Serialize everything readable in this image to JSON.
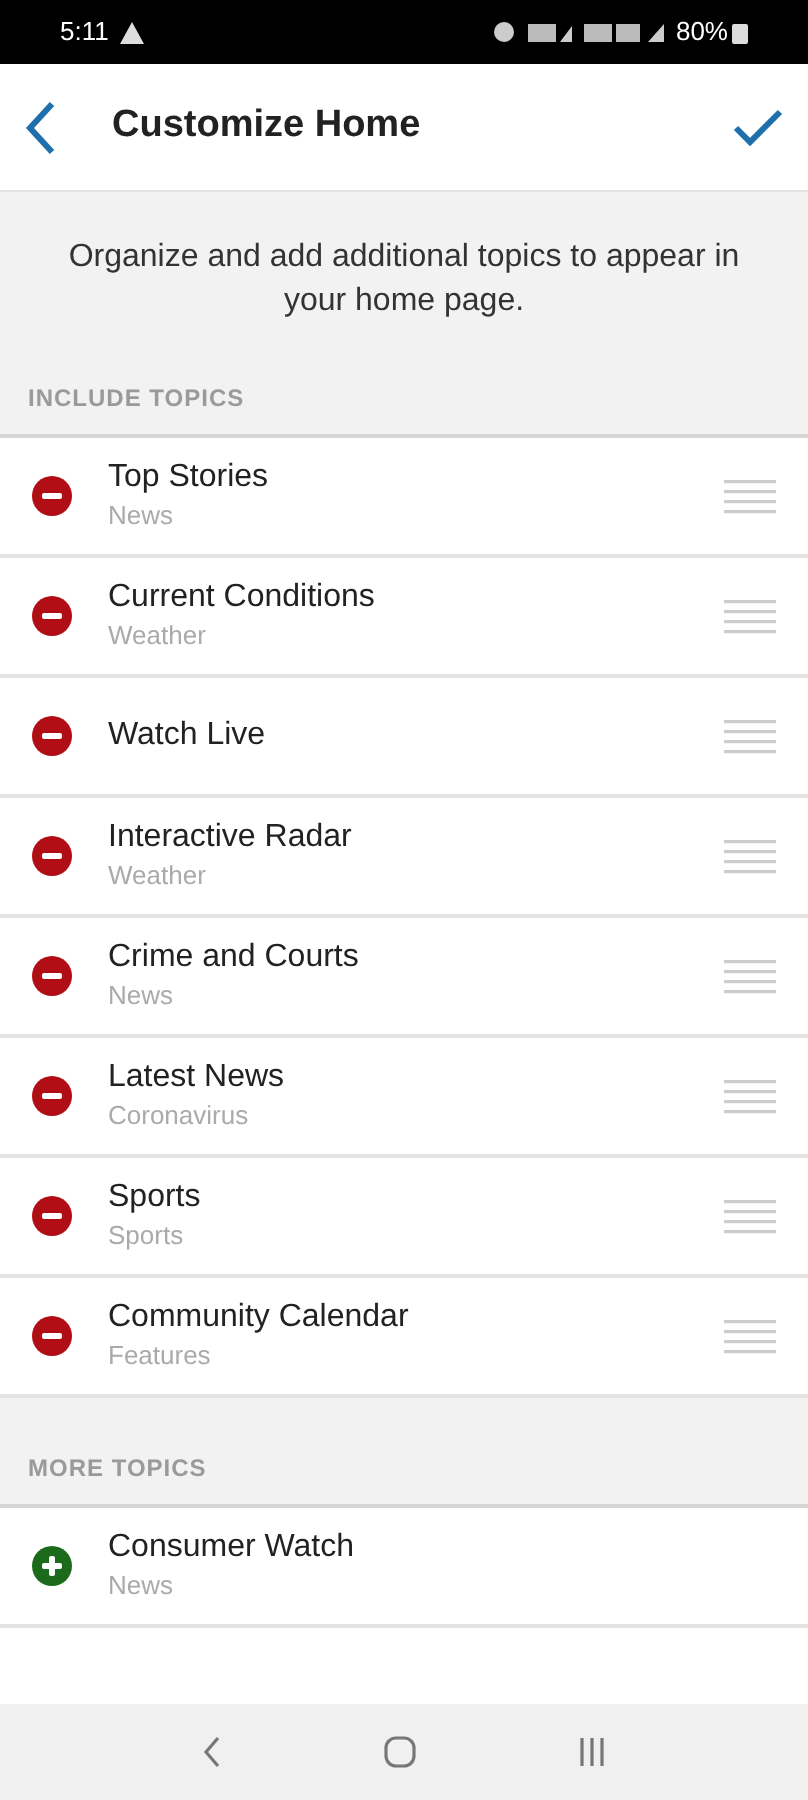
{
  "status_bar": {
    "time": "5:11",
    "battery": "80%"
  },
  "header": {
    "title": "Customize Home"
  },
  "intro": "Organize and add additional topics to appear in your home page.",
  "sections": [
    {
      "title": "INCLUDE TOPICS",
      "items": [
        {
          "name": "Top Stories",
          "category": "News",
          "kind": "remove"
        },
        {
          "name": "Current Conditions",
          "category": "Weather",
          "kind": "remove"
        },
        {
          "name": "Watch Live",
          "kind": "remove"
        },
        {
          "name": "Interactive Radar",
          "category": "Weather",
          "kind": "remove"
        },
        {
          "name": "Crime and Courts",
          "category": "News",
          "kind": "remove"
        },
        {
          "name": "Latest News",
          "category": "Coronavirus",
          "kind": "remove"
        },
        {
          "name": "Sports",
          "category": "Sports",
          "kind": "remove"
        },
        {
          "name": "Community Calendar",
          "category": "Features",
          "kind": "remove"
        }
      ]
    },
    {
      "title": "MORE TOPICS",
      "items": [
        {
          "name": "Consumer Watch",
          "category": "News",
          "kind": "add"
        }
      ]
    }
  ]
}
